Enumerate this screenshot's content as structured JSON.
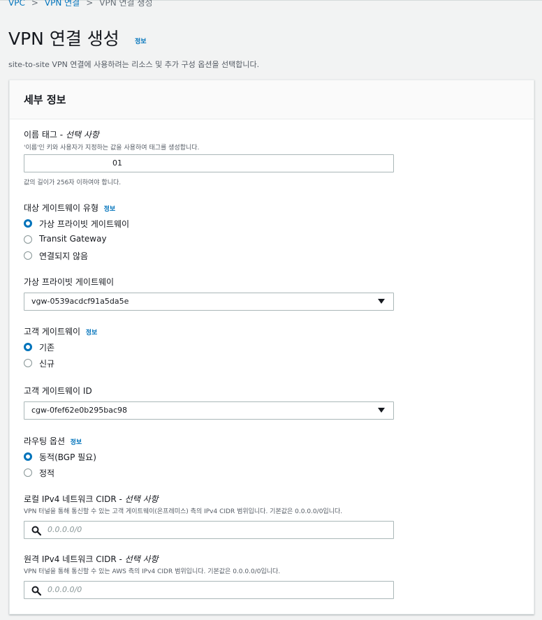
{
  "breadcrumb": [
    "VPC",
    "VPN 연결",
    "VPN 연결 생성"
  ],
  "page": {
    "title": "VPN 연결 생성",
    "info_label": "정보",
    "subtitle": "site-to-site VPN 연결에 사용하려는 리소스 및 추가 구성 옵션을 선택합니다."
  },
  "panel": {
    "title": "세부 정보"
  },
  "name_tag": {
    "label": "이름 태그 -",
    "optional": "선택 사항",
    "description": "'이름'인 키와 사용자가 지정하는 값을 사용하여 태그를 생성합니다.",
    "value": "01",
    "constraint": "값의 길이가 256자 이하여야 합니다."
  },
  "target_gateway_type": {
    "label": "대상 게이트웨이 유형",
    "info_label": "정보",
    "options": [
      {
        "label": "가상 프라이빗 게이트웨이",
        "checked": true
      },
      {
        "label": "Transit Gateway",
        "checked": false
      },
      {
        "label": "연결되지 않음",
        "checked": false
      }
    ]
  },
  "virtual_private_gateway": {
    "label": "가상 프라이빗 게이트웨이",
    "value": "vgw-0539acdcf91a5da5e"
  },
  "customer_gateway": {
    "label": "고객 게이트웨이",
    "info_label": "정보",
    "options": [
      {
        "label": "기존",
        "checked": true
      },
      {
        "label": "신규",
        "checked": false
      }
    ]
  },
  "customer_gateway_id": {
    "label": "고객 게이트웨이 ID",
    "value": "cgw-0fef62e0b295bac98"
  },
  "routing_options": {
    "label": "라우팅 옵션",
    "info_label": "정보",
    "options": [
      {
        "label": "동적(BGP 필요)",
        "checked": true
      },
      {
        "label": "정적",
        "checked": false
      }
    ]
  },
  "local_cidr": {
    "label": "로컬 IPv4 네트워크 CIDR -",
    "optional": "선택 사항",
    "description": "VPN 터널을 통해 통신할 수 있는 고객 게이트웨이(온프레미스) 측의 IPv4 CIDR 범위입니다. 기본값은 0.0.0.0/0입니다.",
    "placeholder": "0.0.0.0/0"
  },
  "remote_cidr": {
    "label": "원격 IPv4 네트워크 CIDR -",
    "optional": "선택 사항",
    "description": "VPN 터널을 통해 통신할 수 있는 AWS 측의 IPv4 CIDR 범위입니다. 기본값은 0.0.0.0/0입니다.",
    "placeholder": "0.0.0.0/0"
  },
  "colors": {
    "link": "#0073bb",
    "selected_radio": "#0073bb",
    "background": "#f2f3f3"
  }
}
